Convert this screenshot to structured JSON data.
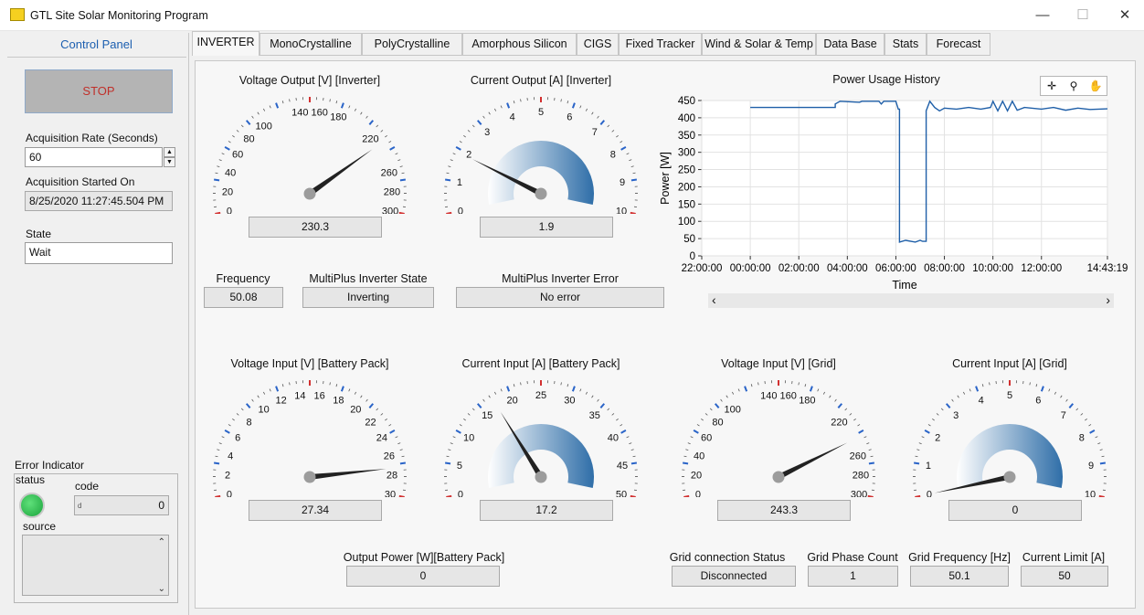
{
  "window": {
    "title": "GTL Site Solar Monitoring Program",
    "minimize": "—",
    "maximize": "☐",
    "close": "✕"
  },
  "control_panel": {
    "title": "Control Panel",
    "stop_label": "STOP",
    "acq_rate_label": "Acquisition Rate (Seconds)",
    "acq_rate_value": "60",
    "acq_started_label": "Acquisition Started On",
    "acq_started_value": "8/25/2020 11:27:45.504 PM",
    "state_label": "State",
    "state_value": "Wait",
    "error_indicator_label": "Error Indicator",
    "status_label": "status",
    "code_label": "code",
    "code_prefix": "d",
    "code_value": "0",
    "source_label": "source"
  },
  "tabs": [
    "INVERTER",
    "MonoCrystalline",
    "PolyCrystalline",
    "Amorphous Silicon",
    "CIGS",
    "Fixed Tracker",
    "Wind & Solar & Temp",
    "Data Base",
    "Stats",
    "Forecast"
  ],
  "gauges": [
    {
      "id": "vout",
      "title": "Voltage Output [V] [Inverter]",
      "min": 0,
      "max": 300,
      "value": 230.3,
      "display": "230.3",
      "ticks": [
        "0",
        "20",
        "40",
        "60",
        "80",
        "100",
        "140",
        "160",
        "180",
        "220",
        "260",
        "280",
        "300"
      ],
      "fill": false
    },
    {
      "id": "iout",
      "title": "Current Output [A] [Inverter]",
      "min": 0,
      "max": 10,
      "value": 1.9,
      "display": "1.9",
      "ticks": [
        "0",
        "1",
        "2",
        "3",
        "4",
        "5",
        "6",
        "7",
        "8",
        "9",
        "10"
      ],
      "fill": true
    },
    {
      "id": "vbat",
      "title": "Voltage Input [V] [Battery Pack]",
      "min": 0,
      "max": 30,
      "value": 27.34,
      "display": "27.34",
      "ticks": [
        "0",
        "2",
        "4",
        "6",
        "8",
        "10",
        "12",
        "14",
        "16",
        "18",
        "20",
        "22",
        "24",
        "26",
        "28",
        "30"
      ],
      "fill": false
    },
    {
      "id": "ibat",
      "title": "Current Input [A] [Battery Pack]",
      "min": 0,
      "max": 50,
      "value": 17.2,
      "display": "17.2",
      "ticks": [
        "0",
        "5",
        "10",
        "15",
        "20",
        "25",
        "30",
        "35",
        "40",
        "45",
        "50"
      ],
      "fill": true
    },
    {
      "id": "vgrid",
      "title": "Voltage Input [V] [Grid]",
      "min": 0,
      "max": 300,
      "value": 243.3,
      "display": "243.3",
      "ticks": [
        "0",
        "20",
        "40",
        "60",
        "80",
        "100",
        "140",
        "160",
        "180",
        "220",
        "260",
        "280",
        "300"
      ],
      "fill": false
    },
    {
      "id": "igrid",
      "title": "Current Input [A] [Grid]",
      "min": 0,
      "max": 10,
      "value": 0,
      "display": "0",
      "ticks": [
        "0",
        "1",
        "2",
        "3",
        "4",
        "5",
        "6",
        "7",
        "8",
        "9",
        "10"
      ],
      "fill": true
    }
  ],
  "indicators": {
    "frequency_label": "Frequency",
    "frequency_value": "50.08",
    "inv_state_label": "MultiPlus Inverter State",
    "inv_state_value": "Inverting",
    "inv_error_label": "MultiPlus Inverter Error",
    "inv_error_value": "No error",
    "out_power_label": "Output Power [W][Battery Pack]",
    "out_power_value": "0",
    "grid_status_label": "Grid connection Status",
    "grid_status_value": "Disconnected",
    "grid_phase_label": "Grid Phase Count",
    "grid_phase_value": "1",
    "grid_freq_label": "Grid Frequency [Hz]",
    "grid_freq_value": "50.1",
    "current_limit_label": "Current Limit [A]",
    "current_limit_value": "50"
  },
  "chart_data": {
    "type": "line",
    "title": "Power Usage History",
    "xlabel": "Time",
    "ylabel": "Power [W]",
    "x_ticks": [
      "22:00:00",
      "00:00:00",
      "02:00:00",
      "04:00:00",
      "06:00:00",
      "08:00:00",
      "10:00:00",
      "12:00:00",
      "14:43:19"
    ],
    "y_ticks": [
      "0",
      "50",
      "100",
      "150",
      "200",
      "250",
      "300",
      "350",
      "400",
      "450"
    ],
    "ylim": [
      0,
      450
    ],
    "xlim_hours": [
      -2,
      14.72
    ],
    "series": [
      {
        "color": "#1f5fa8",
        "points": [
          [
            0.0,
            430
          ],
          [
            3.5,
            430
          ],
          [
            3.5,
            440
          ],
          [
            3.7,
            448
          ],
          [
            4.5,
            445
          ],
          [
            4.6,
            448
          ],
          [
            5.3,
            448
          ],
          [
            5.4,
            440
          ],
          [
            5.5,
            448
          ],
          [
            6.0,
            448
          ],
          [
            6.1,
            425
          ],
          [
            6.15,
            425
          ],
          [
            6.15,
            40
          ],
          [
            6.4,
            45
          ],
          [
            6.8,
            40
          ],
          [
            7.0,
            45
          ],
          [
            7.1,
            42
          ],
          [
            7.25,
            42
          ],
          [
            7.25,
            420
          ],
          [
            7.4,
            448
          ],
          [
            7.6,
            430
          ],
          [
            7.8,
            420
          ],
          [
            8.0,
            428
          ],
          [
            8.5,
            425
          ],
          [
            9.0,
            430
          ],
          [
            9.5,
            425
          ],
          [
            9.9,
            430
          ],
          [
            10.0,
            448
          ],
          [
            10.2,
            420
          ],
          [
            10.4,
            448
          ],
          [
            10.6,
            420
          ],
          [
            10.8,
            448
          ],
          [
            11.0,
            422
          ],
          [
            11.3,
            430
          ],
          [
            12.0,
            425
          ],
          [
            12.5,
            430
          ],
          [
            13.0,
            422
          ],
          [
            13.5,
            428
          ],
          [
            14.0,
            424
          ],
          [
            14.72,
            426
          ]
        ]
      }
    ]
  },
  "chart_scrollbar": {
    "left": "‹",
    "right": "›"
  }
}
